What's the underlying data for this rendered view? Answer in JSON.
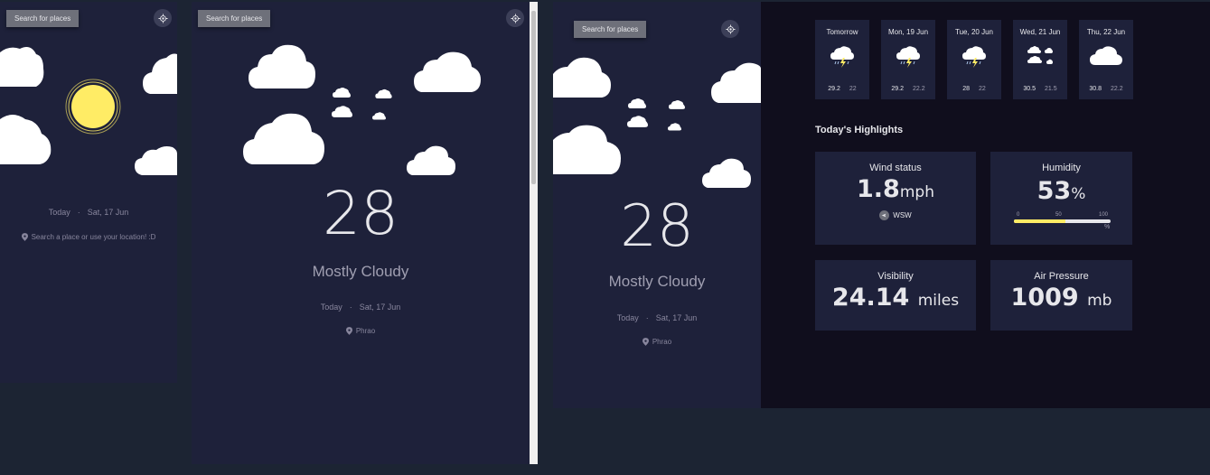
{
  "panel_small": {
    "search_label": "Search for places",
    "date": {
      "day": "Today",
      "separator": "·",
      "date": "Sat, 17 Jun"
    },
    "location_hint": "Search a place or use your location! :D"
  },
  "panel_mid": {
    "search_label": "Search for places",
    "temperature": "28",
    "condition": "Mostly Cloudy",
    "date": {
      "day": "Today",
      "separator": "·",
      "date": "Sat, 17 Jun"
    },
    "location": "Phrao"
  },
  "panel_large": {
    "search_label": "Search for places",
    "temperature": "28",
    "condition": "Mostly Cloudy",
    "date": {
      "day": "Today",
      "separator": "·",
      "date": "Sat, 17 Jun"
    },
    "location": "Phrao"
  },
  "forecast": [
    {
      "day": "Tomorrow",
      "max": "29.2",
      "min": "22",
      "icon": "thunderstorm-icon"
    },
    {
      "day": "Mon, 19 Jun",
      "max": "29.2",
      "min": "22.2",
      "icon": "thunderstorm-icon"
    },
    {
      "day": "Tue, 20 Jun",
      "max": "28",
      "min": "22",
      "icon": "thunderstorm-icon"
    },
    {
      "day": "Wed, 21 Jun",
      "max": "30.5",
      "min": "21.5",
      "icon": "scattered-clouds-icon"
    },
    {
      "day": "Thu, 22 Jun",
      "max": "30.8",
      "min": "22.2",
      "icon": "cloud-icon"
    }
  ],
  "highlights": {
    "title": "Today's Highlights",
    "wind": {
      "label": "Wind status",
      "value": "1.8",
      "unit": "mph",
      "direction": "WSW"
    },
    "humidity": {
      "label": "Humidity",
      "value": "53",
      "unit": "%",
      "fraction": 0.53,
      "scale_min": "0",
      "scale_mid": "50",
      "scale_max": "100",
      "scale_unit": "%"
    },
    "visibility": {
      "label": "Visibility",
      "value": "24.14",
      "unit": "miles"
    },
    "pressure": {
      "label": "Air Pressure",
      "value": "1009",
      "unit": "mb"
    }
  },
  "colors": {
    "panel": "#1e213a",
    "background": "#100e1d",
    "sun": "#ffec65",
    "humidity_bar": "#ffec65",
    "button": "#6e707a"
  }
}
